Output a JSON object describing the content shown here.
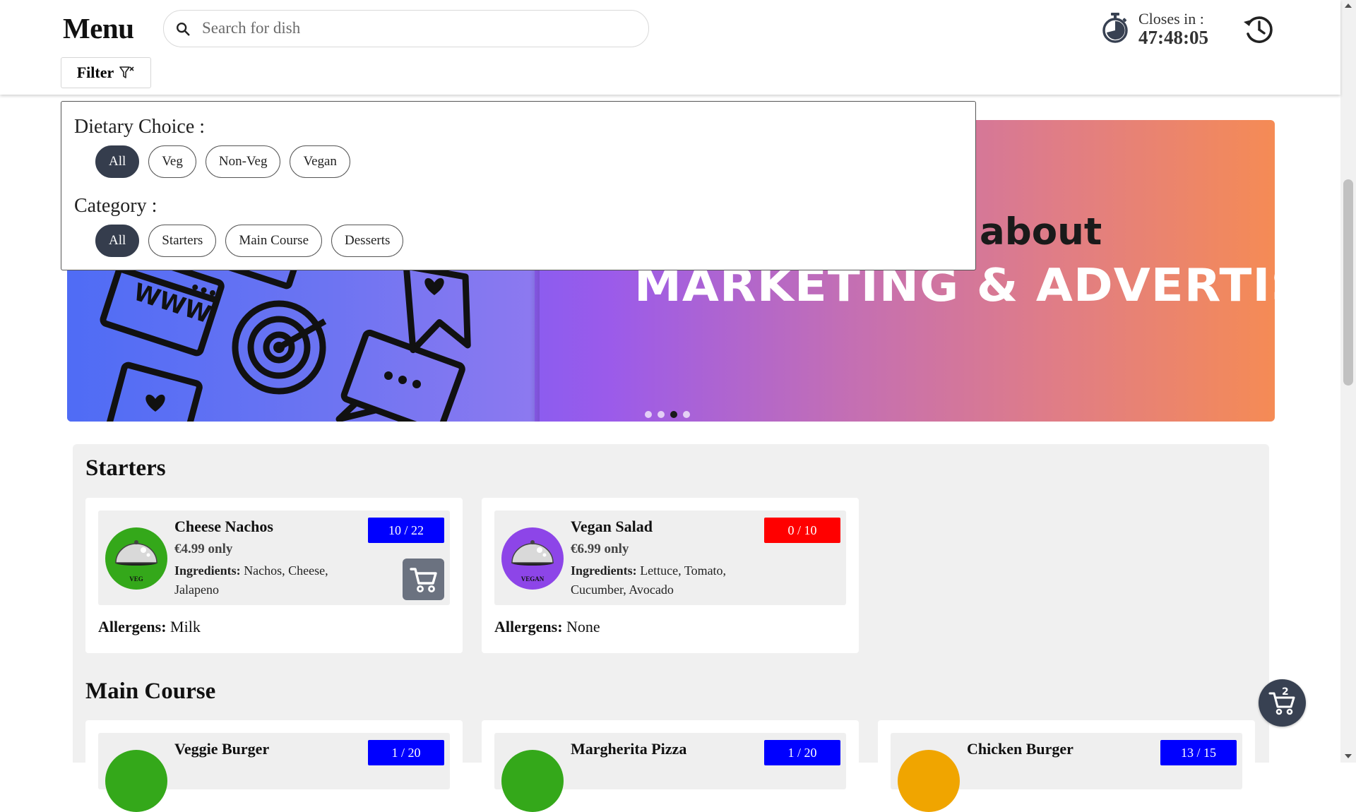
{
  "header": {
    "title": "Menu",
    "search_placeholder": "Search for dish",
    "search_value": "",
    "filter_label": "Filter",
    "closes_label": "Closes in :",
    "closes_time": "47:48:05"
  },
  "filter_panel": {
    "dietary_label": "Dietary Choice :",
    "dietary_options": [
      "All",
      "Veg",
      "Non-Veg",
      "Vegan"
    ],
    "dietary_selected": "All",
    "category_label": "Category :",
    "category_options": [
      "All",
      "Starters",
      "Main Course",
      "Desserts"
    ],
    "category_selected": "All"
  },
  "banner": {
    "about_text": "about",
    "headline": "MARKETING & ADVERTISING",
    "slide_count": 4,
    "active_slide": 3
  },
  "sections": [
    {
      "title": "Starters",
      "dishes": [
        {
          "name": "Cheese Nachos",
          "price": "€4.99 only",
          "ingredients_label": "Ingredients:",
          "ingredients": "Nachos, Cheese, Jalapeno",
          "stock": "10 / 22",
          "diet": "VEG",
          "allergens_label": "Allergens:",
          "allergens": "Milk"
        },
        {
          "name": "Vegan Salad",
          "price": "€6.99 only",
          "ingredients_label": "Ingredients:",
          "ingredients": "Lettuce, Tomato, Cucumber, Avocado",
          "stock": "0 / 10",
          "diet": "VEGAN",
          "allergens_label": "Allergens:",
          "allergens": "None"
        }
      ]
    },
    {
      "title": "Main Course",
      "dishes": [
        {
          "name": "Veggie Burger",
          "stock": "1 / 20"
        },
        {
          "name": "Margherita Pizza",
          "stock": "1 / 20"
        },
        {
          "name": "Chicken Burger",
          "stock": "13 / 15"
        }
      ]
    }
  ],
  "cart": {
    "count": "2"
  },
  "colors": {
    "chip_active": "#353d4d",
    "stock_available": "#0000ff",
    "stock_empty": "#ff0000",
    "veg": "#34a81a",
    "vegan": "#8d45e8",
    "non_veg": "#f0a500",
    "cart_button": "#6b7280",
    "float_cart": "#384152"
  }
}
